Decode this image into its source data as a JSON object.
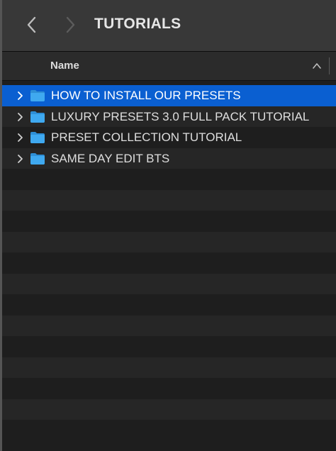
{
  "window": {
    "title": "TUTORIALS"
  },
  "toolbar": {
    "back_icon": "chevron-left-icon",
    "forward_icon": "chevron-right-icon"
  },
  "columns": {
    "name_label": "Name",
    "sort_icon": "chevron-up-icon"
  },
  "items": [
    {
      "label": "HOW TO INSTALL OUR PRESETS",
      "icon": "folder-icon",
      "selected": true
    },
    {
      "label": "LUXURY PRESETS 3.0 FULL PACK TUTORIAL",
      "icon": "folder-icon",
      "selected": false
    },
    {
      "label": "PRESET COLLECTION TUTORIAL",
      "icon": "folder-icon",
      "selected": false
    },
    {
      "label": "SAME DAY EDIT BTS",
      "icon": "folder-icon",
      "selected": false
    }
  ],
  "colors": {
    "selection": "#0a5fd1",
    "folder": "#3fa9f0",
    "background": "#1e1e1e"
  }
}
